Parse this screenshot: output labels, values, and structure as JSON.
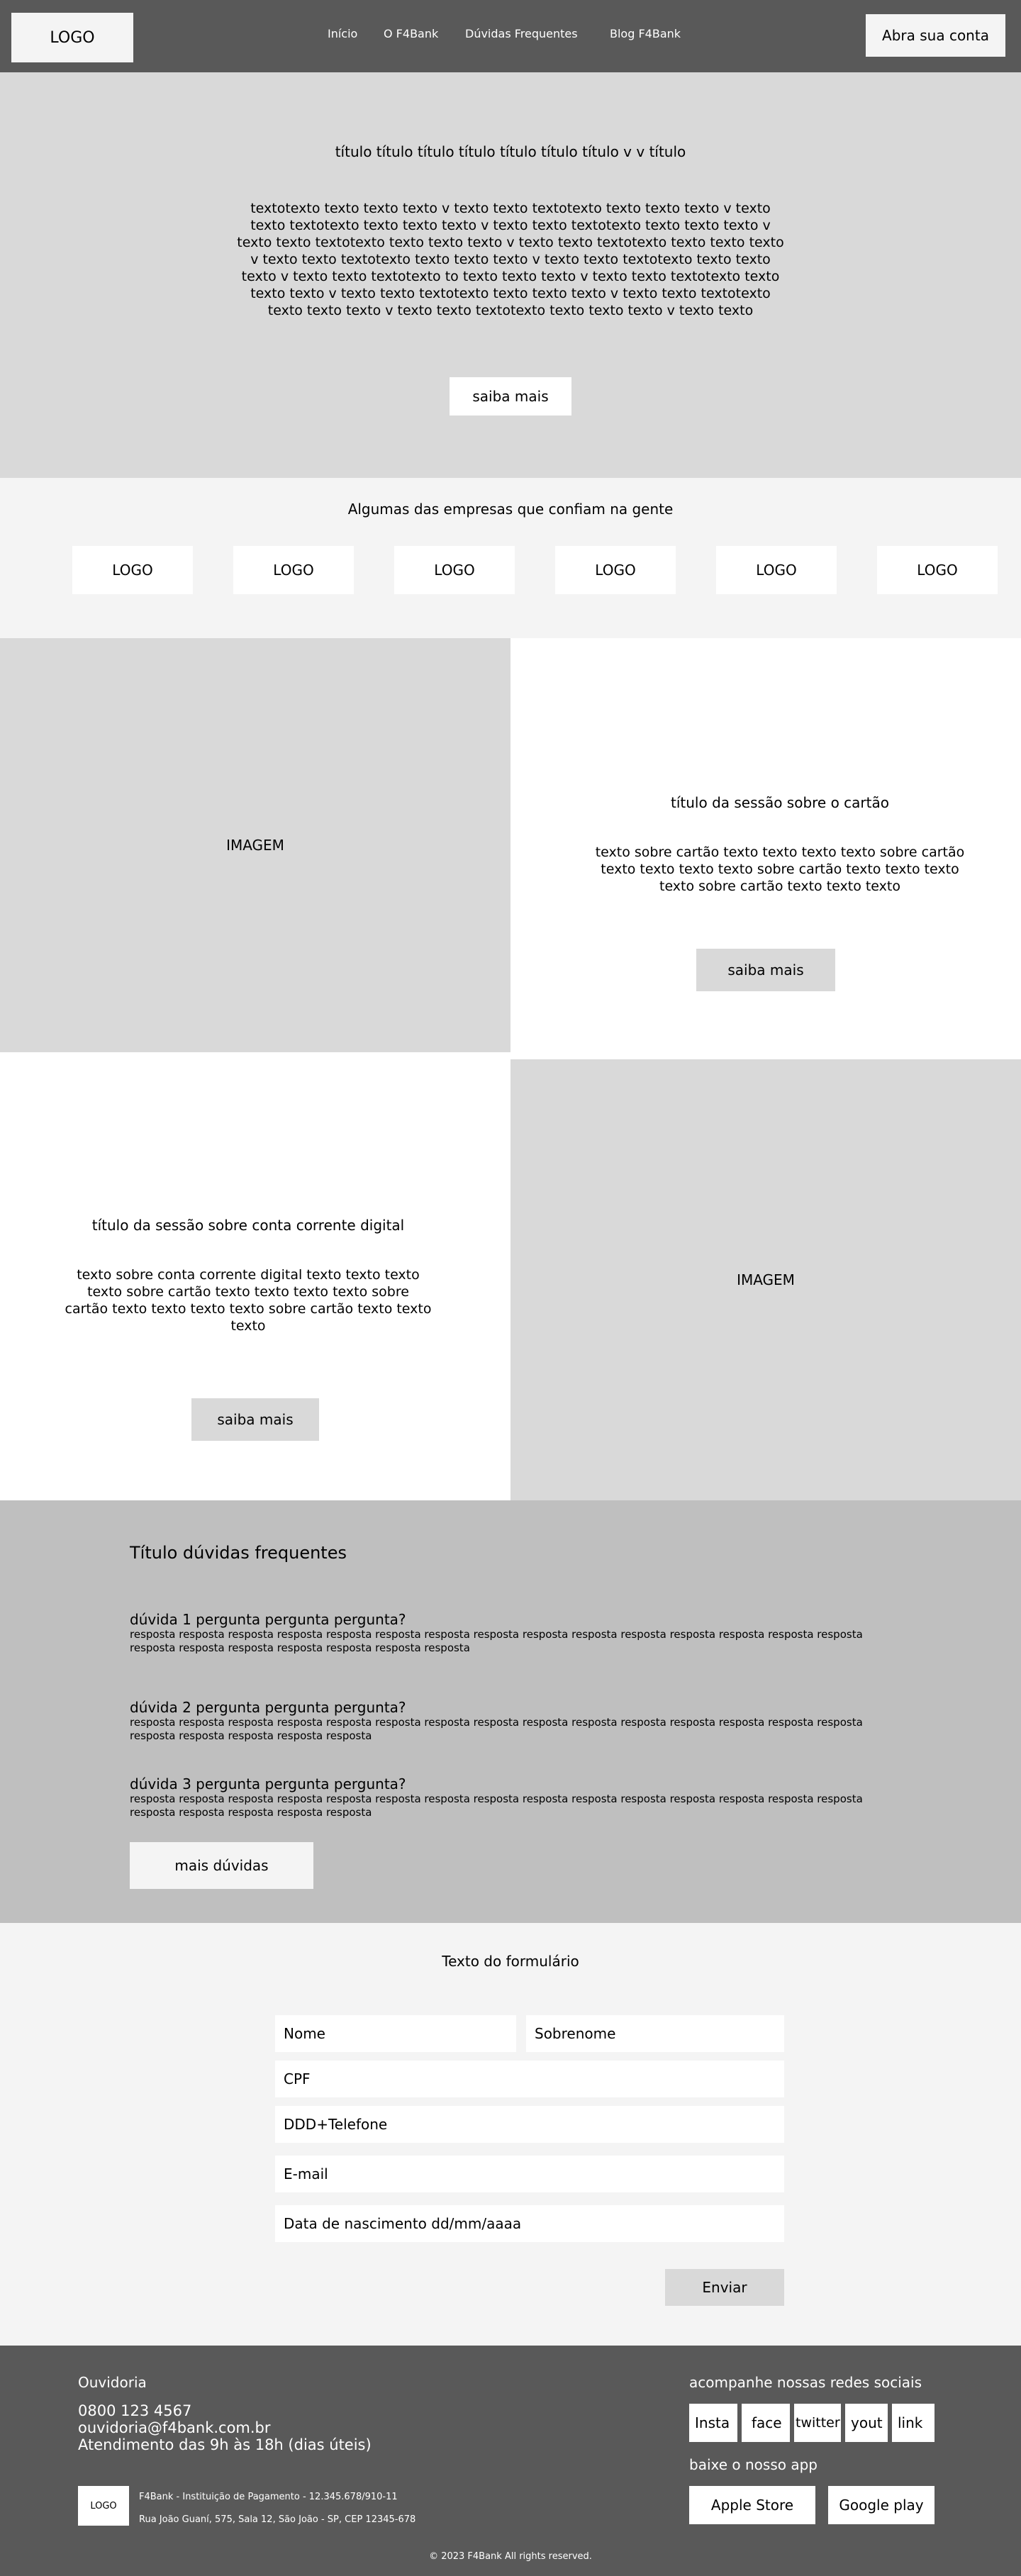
{
  "header": {
    "logo": "LOGO",
    "nav": [
      "Início",
      "O F4Bank",
      "Dúvidas Frequentes",
      "Blog F4Bank"
    ],
    "cta": "Abra sua conta"
  },
  "hero": {
    "title": "título título título título título título título v v título",
    "text": "textotexto texto texto texto v texto texto  textotexto texto texto texto v texto texto textotexto texto texto texto v texto texto textotexto texto texto texto v texto texto textotexto texto texto texto v texto texto textotexto texto texto texto v texto texto textotexto texto texto texto v texto texto textotexto texto texto texto v texto texto textotexto to texto texto texto v texto texto textotexto texto texto texto v texto texto textotexto texto texto texto v texto texto textotexto texto texto texto v texto texto textotexto texto texto texto v texto texto",
    "button": "saiba mais"
  },
  "partners": {
    "title": "Algumas das empresas que confiam na gente",
    "logos": [
      "LOGO",
      "LOGO",
      "LOGO",
      "LOGO",
      "LOGO",
      "LOGO"
    ]
  },
  "card_section": {
    "image_label": "IMAGEM",
    "title": "título da sessão sobre o cartão",
    "text": "texto sobre cartão texto texto texto texto sobre cartão texto texto texto texto sobre cartão texto texto texto texto sobre cartão texto texto texto",
    "button": "saiba mais"
  },
  "account_section": {
    "title": "título da sessão sobre conta corrente digital",
    "text": "texto sobre conta corrente digital texto texto texto texto sobre cartão texto texto texto texto sobre cartão texto texto texto texto sobre cartão texto texto texto",
    "button": "saiba mais",
    "image_label": "IMAGEM"
  },
  "faq": {
    "title": "Título dúvidas frequentes",
    "items": [
      {
        "question": "dúvida 1 pergunta pergunta pergunta?",
        "answer": "resposta resposta resposta resposta resposta resposta resposta resposta resposta resposta resposta resposta resposta resposta resposta resposta resposta resposta resposta resposta resposta resposta"
      },
      {
        "question": "dúvida 2 pergunta pergunta pergunta?",
        "answer": "resposta resposta resposta resposta resposta resposta resposta resposta resposta resposta resposta resposta resposta resposta resposta resposta resposta resposta resposta resposta"
      },
      {
        "question": "dúvida 3 pergunta pergunta pergunta?",
        "answer": "resposta resposta resposta resposta resposta resposta resposta resposta resposta resposta resposta resposta resposta resposta resposta resposta resposta resposta resposta resposta"
      }
    ],
    "button": "mais dúvidas"
  },
  "form": {
    "title": "Texto do formulário",
    "placeholders": {
      "nome": "Nome",
      "sobrenome": "Sobrenome",
      "cpf": "CPF",
      "telefone": "DDD+Telefone",
      "email": "E-mail",
      "nascimento": "Data de nascimento dd/mm/aaaa"
    },
    "submit": "Enviar"
  },
  "footer": {
    "ouvidoria_title": "Ouvidoria",
    "phone": "0800 123 4567",
    "email": "ouvidoria@f4bank.com.br",
    "hours": "Atendimento das 9h às 18h (dias úteis)",
    "logo": "LOGO",
    "legal_name": "F4Bank - Instituição de Pagamento - 12.345.678/910-11",
    "address": "Rua João Guaní, 575, Sala 12, São João - SP, CEP 12345-678",
    "social_title": "acompanhe nossas redes sociais",
    "social": [
      "Insta",
      "face",
      "twitter",
      "yout",
      "link"
    ],
    "app_title": "baixe o nosso app",
    "apps": [
      "Apple Store",
      "Google play"
    ],
    "copyright": "© 2023 F4Bank All rights reserved."
  },
  "colors": {
    "header_bg": "#595959",
    "hero_bg": "#d9d9d9",
    "light_bg": "#f4f4f4",
    "faq_bg": "#bfbfbf",
    "footer_bg": "#595959"
  }
}
